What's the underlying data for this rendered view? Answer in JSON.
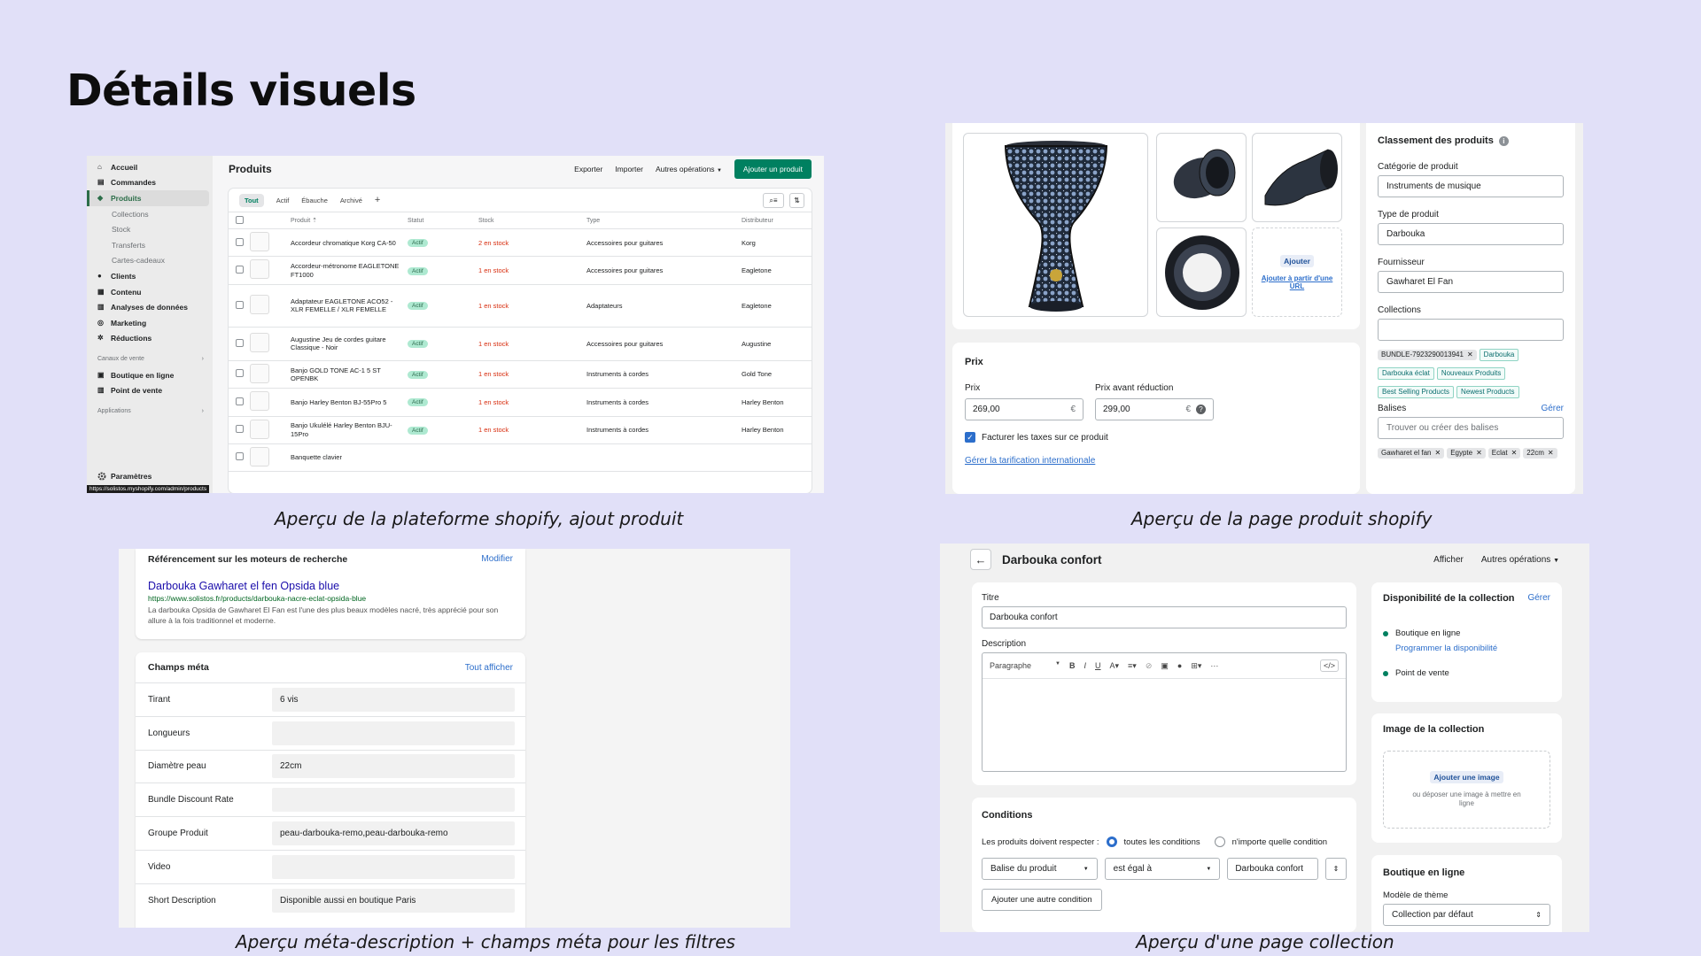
{
  "slide": {
    "title": "Détails visuels",
    "captions": {
      "shot1": "Aperçu de la plateforme shopify, ajout produit",
      "shot2": "Aperçu de la page produit shopify",
      "shot3": "Aperçu méta-description + champs méta pour les filtres",
      "shot4": "Aperçu d'une page collection"
    }
  },
  "shot1": {
    "nav": [
      {
        "label": "Accueil",
        "icon": "home-icon"
      },
      {
        "label": "Commandes",
        "icon": "orders-icon"
      },
      {
        "label": "Produits",
        "icon": "tag-icon",
        "active": true
      },
      {
        "label": "Collections",
        "sub": true
      },
      {
        "label": "Stock",
        "sub": true
      },
      {
        "label": "Transferts",
        "sub": true
      },
      {
        "label": "Cartes-cadeaux",
        "sub": true
      },
      {
        "label": "Clients",
        "icon": "person-icon"
      },
      {
        "label": "Contenu",
        "icon": "content-icon"
      },
      {
        "label": "Analyses de données",
        "icon": "analytics-icon"
      },
      {
        "label": "Marketing",
        "icon": "marketing-icon"
      },
      {
        "label": "Réductions",
        "icon": "discount-icon"
      }
    ],
    "channels_label": "Canaux de vente",
    "channels": [
      {
        "label": "Boutique en ligne",
        "icon": "store-icon"
      },
      {
        "label": "Point de vente",
        "icon": "pos-icon"
      }
    ],
    "apps_label": "Applications",
    "settings_label": "Paramètres",
    "status_url": "https://solistos.myshopify.com/admin/products",
    "page_title": "Produits",
    "export_label": "Exporter",
    "import_label": "Importer",
    "more_label": "Autres opérations",
    "add_product_label": "Ajouter un produit",
    "tabs": [
      "Tout",
      "Actif",
      "Ébauche",
      "Archivé"
    ],
    "columns": [
      "Produit",
      "Statut",
      "Stock",
      "Type",
      "Distributeur"
    ],
    "rows": [
      {
        "product": "Accordeur chromatique Korg CA-50",
        "status": "Actif",
        "stock": "2 en stock",
        "type": "Accessoires pour guitares",
        "vendor": "Korg"
      },
      {
        "product": "Accordeur-métronome EAGLETONE FT1000",
        "status": "Actif",
        "stock": "1 en stock",
        "type": "Accessoires pour guitares",
        "vendor": "Eagletone"
      },
      {
        "product": "Adaptateur EAGLETONE ACO52 - XLR FEMELLE / XLR FEMELLE",
        "status": "Actif",
        "stock": "1 en stock",
        "type": "Adaptateurs",
        "vendor": "Eagletone"
      },
      {
        "product": "Augustine Jeu de cordes guitare Classique - Noir",
        "status": "Actif",
        "stock": "1 en stock",
        "type": "Accessoires pour guitares",
        "vendor": "Augustine"
      },
      {
        "product": "Banjo GOLD TONE AC-1 5 ST OPENBK",
        "status": "Actif",
        "stock": "1 en stock",
        "type": "Instruments à cordes",
        "vendor": "Gold Tone"
      },
      {
        "product": "Banjo Harley Benton BJ-55Pro 5",
        "status": "Actif",
        "stock": "1 en stock",
        "type": "Instruments à cordes",
        "vendor": "Harley Benton"
      },
      {
        "product": "Banjo Ukulélé Harley Benton BJU-15Pro",
        "status": "Actif",
        "stock": "1 en stock",
        "type": "Instruments à cordes",
        "vendor": "Harley Benton"
      },
      {
        "product": "Banquette clavier",
        "status": "",
        "stock": "",
        "type": "",
        "vendor": ""
      }
    ]
  },
  "shot2": {
    "add_label": "Ajouter",
    "add_url_label": "Ajouter à partir d'une URL",
    "price_title": "Prix",
    "price_label": "Prix",
    "price_value": "269,00",
    "compare_label": "Prix avant réduction",
    "compare_value": "299,00",
    "currency": "€",
    "tax_label": "Facturer les taxes sur ce produit",
    "intl_link": "Gérer la tarification internationale",
    "org_title": "Classement des produits",
    "category_label": "Catégorie de produit",
    "category_value": "Instruments de musique",
    "type_label": "Type de produit",
    "type_value": "Darbouka",
    "vendor_label": "Fournisseur",
    "vendor_value": "Gawharet El Fan",
    "collections_label": "Collections",
    "collections": [
      "BUNDLE-7923290013941",
      "Darbouka",
      "Darbouka éclat",
      "Nouveaux Produits",
      "Best Selling Products",
      "Newest Products"
    ],
    "tags_label": "Balises",
    "tags_manage": "Gérer",
    "tags_placeholder": "Trouver ou créer des balises",
    "tags": [
      "Gawharet el fan",
      "Egypte",
      "Eclat",
      "22cm"
    ]
  },
  "shot3": {
    "seo_title": "Référencement sur les moteurs de recherche",
    "seo_edit": "Modifier",
    "seo_page_title": "Darbouka Gawharet el fen Opsida blue",
    "seo_url": "https://www.solistos.fr/products/darbouka-nacre-eclat-opsida-blue",
    "seo_desc": "La darbouka Opsida de Gawharet El Fan est l'une des plus beaux modèles nacré, très apprécié pour son allure à la fois traditionnel et moderne.",
    "meta_title": "Champs méta",
    "meta_all": "Tout afficher",
    "fields": [
      {
        "key": "Tirant",
        "value": "6 vis"
      },
      {
        "key": "Longueurs",
        "value": ""
      },
      {
        "key": "Diamètre peau",
        "value": "22cm"
      },
      {
        "key": "Bundle Discount Rate",
        "value": ""
      },
      {
        "key": "Groupe Produit",
        "value": "peau-darbouka-remo,peau-darbouka-remo"
      },
      {
        "key": "Video",
        "value": ""
      },
      {
        "key": "Short Description",
        "value": "Disponible aussi en boutique Paris"
      }
    ]
  },
  "shot4": {
    "page_title": "Darbouka confort",
    "view_label": "Afficher",
    "more_label": "Autres opérations",
    "title_label": "Titre",
    "title_value": "Darbouka confort",
    "desc_label": "Description",
    "format_label": "Paragraphe",
    "conditions_title": "Conditions",
    "match_label": "Les produits doivent respecter :",
    "all_label": "toutes les conditions",
    "any_label": "n'importe quelle condition",
    "cond_field": "Balise du produit",
    "cond_op": "est égal à",
    "cond_value": "Darbouka confort",
    "add_condition": "Ajouter une autre condition",
    "avail_title": "Disponibilité de la collection",
    "avail_manage": "Gérer",
    "channel_online": "Boutique en ligne",
    "schedule_link": "Programmer la disponibilité",
    "channel_pos": "Point de vente",
    "image_title": "Image de la collection",
    "image_add": "Ajouter une image",
    "image_drop": "ou déposer une image à mettre en ligne",
    "store_title": "Boutique en ligne",
    "template_label": "Modèle de thème",
    "template_value": "Collection par défaut"
  }
}
